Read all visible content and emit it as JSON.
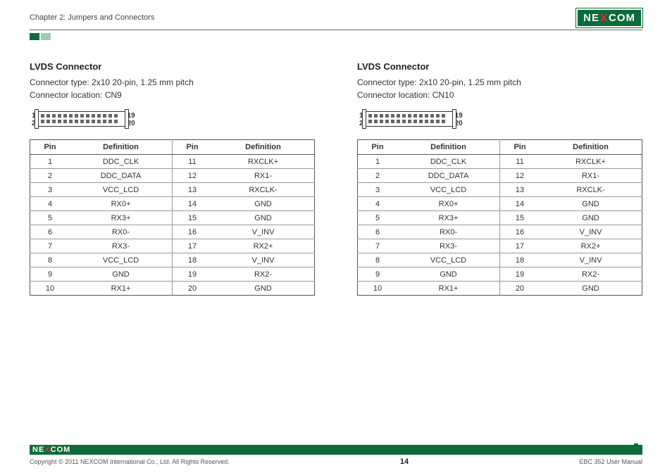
{
  "header": {
    "chapter": "Chapter 2: Jumpers and Connectors",
    "logo_parts": {
      "pre": "NE",
      "x": "X",
      "post": "COM"
    }
  },
  "sections": [
    {
      "title": "LVDS Connector",
      "type_line": "Connector type: 2x10 20-pin, 1.25 mm pitch",
      "loc_line": "Connector location: CN9",
      "diag": {
        "tl": "1",
        "bl": "2",
        "tr": "19",
        "br": "20"
      },
      "head": {
        "pin": "Pin",
        "def": "Definition"
      },
      "rows": [
        {
          "p1": "1",
          "d1": "DDC_CLK",
          "p2": "11",
          "d2": "RXCLK+"
        },
        {
          "p1": "2",
          "d1": "DDC_DATA",
          "p2": "12",
          "d2": "RX1-"
        },
        {
          "p1": "3",
          "d1": "VCC_LCD",
          "p2": "13",
          "d2": "RXCLK-"
        },
        {
          "p1": "4",
          "d1": "RX0+",
          "p2": "14",
          "d2": "GND"
        },
        {
          "p1": "5",
          "d1": "RX3+",
          "p2": "15",
          "d2": "GND"
        },
        {
          "p1": "6",
          "d1": "RX0-",
          "p2": "16",
          "d2": "V_INV"
        },
        {
          "p1": "7",
          "d1": "RX3-",
          "p2": "17",
          "d2": "RX2+"
        },
        {
          "p1": "8",
          "d1": "VCC_LCD",
          "p2": "18",
          "d2": "V_INV"
        },
        {
          "p1": "9",
          "d1": "GND",
          "p2": "19",
          "d2": "RX2-"
        },
        {
          "p1": "10",
          "d1": "RX1+",
          "p2": "20",
          "d2": "GND"
        }
      ]
    },
    {
      "title": "LVDS Connector",
      "type_line": "Connector type: 2x10 20-pin, 1.25 mm pitch",
      "loc_line": "Connector location: CN10",
      "diag": {
        "tl": "1",
        "bl": "2",
        "tr": "19",
        "br": "20"
      },
      "head": {
        "pin": "Pin",
        "def": "Definition"
      },
      "rows": [
        {
          "p1": "1",
          "d1": "DDC_CLK",
          "p2": "11",
          "d2": "RXCLK+"
        },
        {
          "p1": "2",
          "d1": "DDC_DATA",
          "p2": "12",
          "d2": "RX1-"
        },
        {
          "p1": "3",
          "d1": "VCC_LCD",
          "p2": "13",
          "d2": "RXCLK-"
        },
        {
          "p1": "4",
          "d1": "RX0+",
          "p2": "14",
          "d2": "GND"
        },
        {
          "p1": "5",
          "d1": "RX3+",
          "p2": "15",
          "d2": "GND"
        },
        {
          "p1": "6",
          "d1": "RX0-",
          "p2": "16",
          "d2": "V_INV"
        },
        {
          "p1": "7",
          "d1": "RX3-",
          "p2": "17",
          "d2": "RX2+"
        },
        {
          "p1": "8",
          "d1": "VCC_LCD",
          "p2": "18",
          "d2": "V_INV"
        },
        {
          "p1": "9",
          "d1": "GND",
          "p2": "19",
          "d2": "RX2-"
        },
        {
          "p1": "10",
          "d1": "RX1+",
          "p2": "20",
          "d2": "GND"
        }
      ]
    }
  ],
  "footer": {
    "copyright": "Copyright © 2011 NEXCOM International Co., Ltd. All Rights Reserved.",
    "page": "14",
    "doc": "EBC 352 User Manual",
    "logo_parts": {
      "pre": "NE",
      "x": "X",
      "post": "COM"
    }
  }
}
